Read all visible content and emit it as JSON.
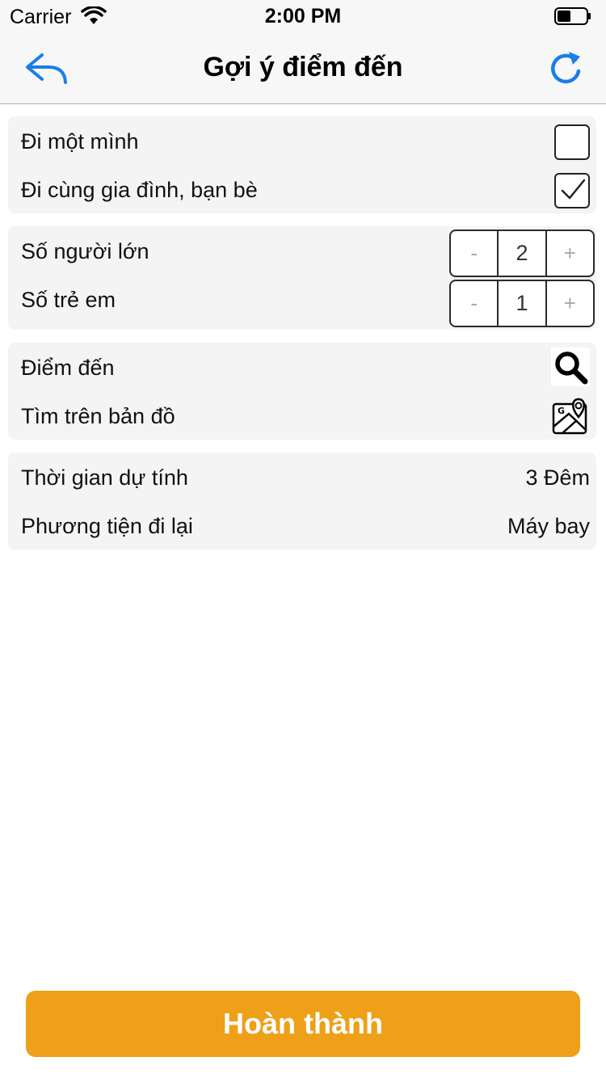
{
  "status_bar": {
    "carrier": "Carrier",
    "time": "2:00 PM"
  },
  "navbar": {
    "title": "Gợi ý điểm đến"
  },
  "companions": {
    "alone_label": "Đi một mình",
    "alone_checked": false,
    "group_label": "Đi cùng gia đình, bạn bè",
    "group_checked": true
  },
  "people": {
    "adults_label": "Số người lớn",
    "adults_value": "2",
    "children_label": "Số trẻ em",
    "children_value": "1",
    "minus": "-",
    "plus": "+"
  },
  "destination": {
    "destination_label": "Điểm đến",
    "map_label": "Tìm trên bản đồ"
  },
  "trip": {
    "duration_label": "Thời gian dự tính",
    "duration_value": "3 Đêm",
    "transport_label": "Phương tiện đi lại",
    "transport_value": "Máy bay"
  },
  "footer": {
    "done_label": "Hoàn thành"
  },
  "colors": {
    "accent": "#eda018",
    "nav_icon": "#1a7ee6"
  }
}
